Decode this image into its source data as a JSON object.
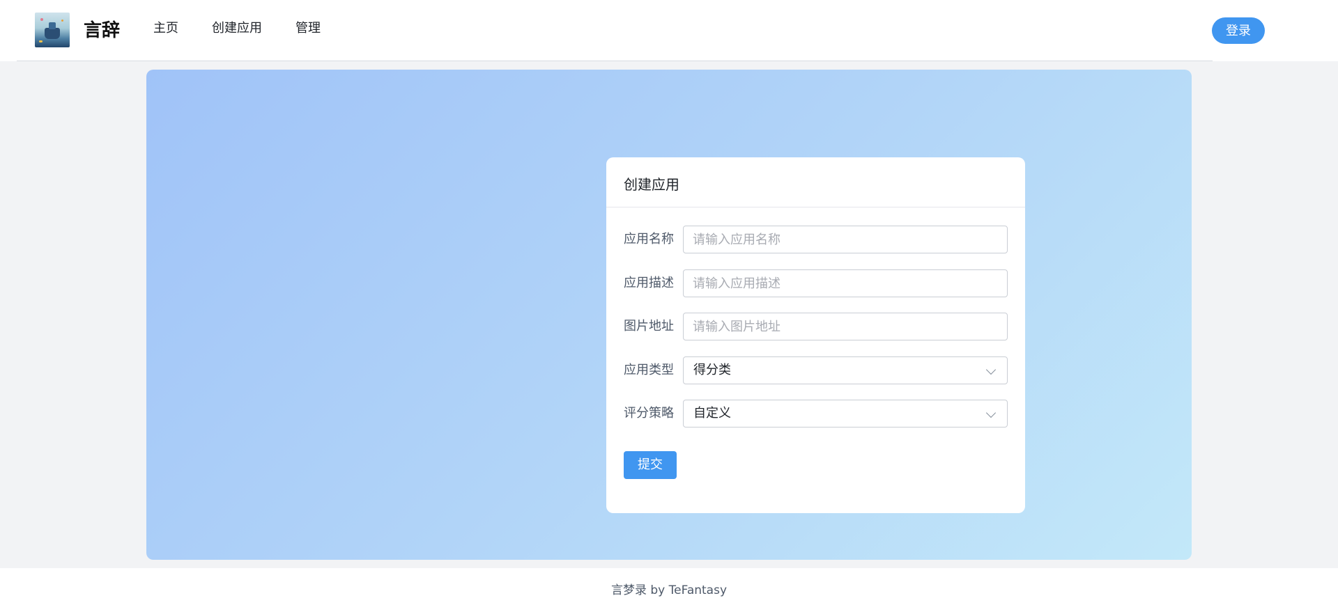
{
  "header": {
    "logo_icon": "app-logo-image",
    "app_name": "言辞",
    "nav": [
      {
        "label": "主页"
      },
      {
        "label": "创建应用"
      },
      {
        "label": "管理"
      }
    ],
    "login_label": "登录"
  },
  "form": {
    "title": "创建应用",
    "fields": [
      {
        "label": "应用名称",
        "placeholder": "请输入应用名称",
        "value": ""
      },
      {
        "label": "应用描述",
        "placeholder": "请输入应用描述",
        "value": ""
      },
      {
        "label": "图片地址",
        "placeholder": "请输入图片地址",
        "value": ""
      }
    ],
    "selects": [
      {
        "label": "应用类型",
        "value": "得分类",
        "icon": "chevron-down-icon"
      },
      {
        "label": "评分策略",
        "value": "自定义",
        "icon": "chevron-down-icon"
      }
    ],
    "submit_label": "提交"
  },
  "footer": {
    "text": "言梦录 by TeFantasy"
  },
  "colors": {
    "primary": "#4096f0",
    "gradient_start": "#a0c3f8",
    "gradient_end": "#c3e8f9"
  }
}
